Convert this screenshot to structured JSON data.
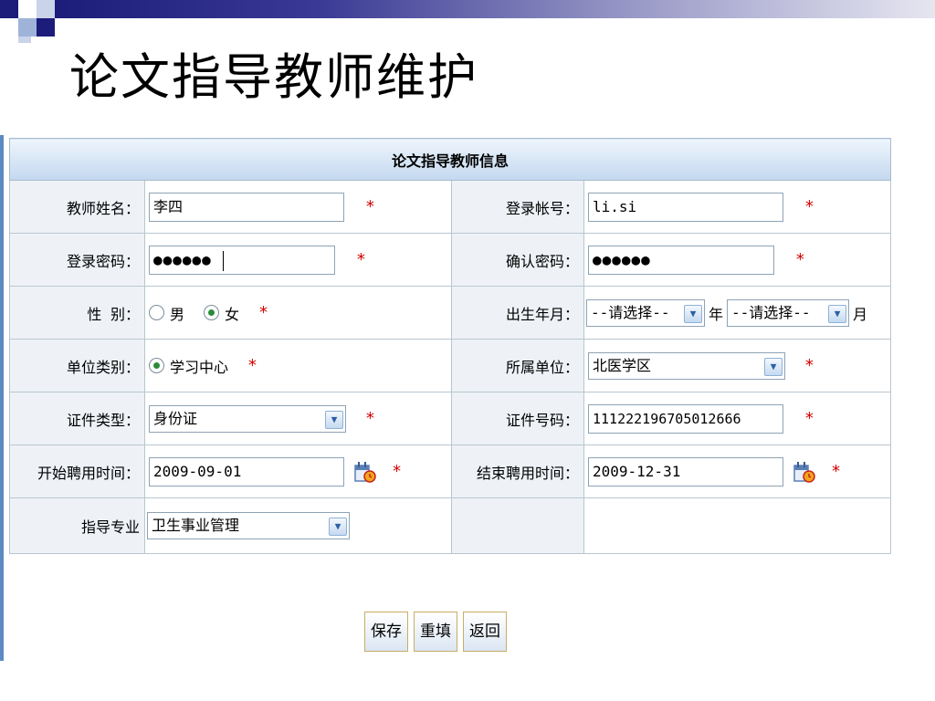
{
  "slide": {
    "title": "论文指导教师维护"
  },
  "form": {
    "heading": "论文指导教师信息",
    "required_mark": "*",
    "teacher_name": {
      "label": "教师姓名：",
      "value": "李四"
    },
    "login_account": {
      "label": "登录帐号：",
      "value": "li.si"
    },
    "login_password": {
      "label": "登录密码：",
      "value": "●●●●●●"
    },
    "confirm_password": {
      "label": "确认密码：",
      "value": "●●●●●●"
    },
    "gender": {
      "label": "性 别：",
      "options": [
        "男",
        "女"
      ],
      "selected": "女"
    },
    "birth": {
      "label": "出生年月：",
      "year_select": "--请选择--",
      "year_unit": "年",
      "month_select": "--请选择--",
      "month_unit": "月"
    },
    "unit_type": {
      "label": "单位类别：",
      "option": "学习中心",
      "selected": true
    },
    "affiliated_unit": {
      "label": "所属单位：",
      "value": "北医学区"
    },
    "id_type": {
      "label": "证件类型：",
      "value": "身份证"
    },
    "id_number": {
      "label": "证件号码：",
      "value": "111222196705012666"
    },
    "hire_start": {
      "label": "开始聘用时间：",
      "value": "2009-09-01"
    },
    "hire_end": {
      "label": "结束聘用时间：",
      "value": "2009-12-31"
    },
    "major": {
      "label": "指导专业",
      "value": "卫生事业管理"
    }
  },
  "buttons": {
    "save": "保存",
    "reset": "重填",
    "back": "返回"
  },
  "colors": {
    "title_band": "#1c1c7a",
    "header_bg": "#c3d8ef",
    "label_bg": "#eef2f7",
    "required": "#d40000",
    "radio_dot": "#2b8c3a"
  }
}
